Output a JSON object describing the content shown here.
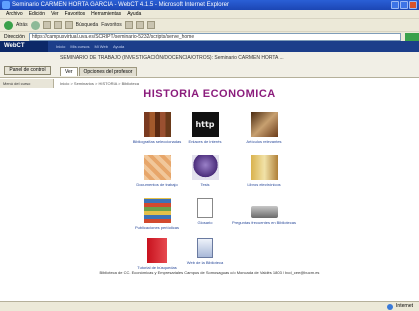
{
  "window": {
    "title": "Seminario CARMEN HORTA GARCIA - WebCT 4.1.5 - Microsoft Internet Explorer"
  },
  "menu": [
    "Archivo",
    "Edición",
    "Ver",
    "Favoritos",
    "Herramientas",
    "Ayuda"
  ],
  "toolbar": {
    "back_label": "Atrás",
    "search_label": "Búsqueda",
    "favorites_label": "Favoritos"
  },
  "address": {
    "label": "Dirección",
    "value": "https://campusvirtual.uva.es/SCRIPT/seminario-5232/scripts/serve_home"
  },
  "app": {
    "logo": "WebCT",
    "nav": [
      "Inicio",
      "Mis cursos",
      "Mi Web",
      "Ayuda"
    ]
  },
  "course": {
    "title": "SEMINARIO DE TRABAJO (INVESTIGACIÓN/DOCENCIA/OTROS): Seminario CARMEN HORTA ...",
    "panel_button": "Panel de control",
    "tabs": [
      "Ver",
      "Opciones del profesor"
    ]
  },
  "breadcrumb": {
    "menu": "Menú del curso",
    "path": "Inicio > Seminarios > HISTORIA > Biblioteca"
  },
  "page_title": "HISTORIA ECONOMICA",
  "items": [
    {
      "label": "Bibliografías seleccionadas",
      "icon": "books-icon"
    },
    {
      "label": "Enlaces de interés",
      "icon": "http-icon"
    },
    {
      "label": "Artículos relevantes",
      "icon": "open-book-icon"
    },
    {
      "label": "Documentos de trabajo",
      "icon": "documents-icon"
    },
    {
      "label": "Tesis",
      "icon": "graduation-cap-icon"
    },
    {
      "label": "Libros electrónicos",
      "icon": "ebooks-icon"
    },
    {
      "label": "Publicaciones periódicas",
      "icon": "periodicals-icon"
    },
    {
      "label": "Glosario",
      "icon": "board-icon"
    },
    {
      "label": "Preguntas frecuentes en Bibliotecas",
      "icon": "projector-icon"
    },
    {
      "label": "Tutorial de búsquedas",
      "icon": "folder-icon"
    },
    {
      "label": "Web de la Biblioteca",
      "icon": "file-icon"
    }
  ],
  "footer": "Biblioteca de CC. Económicas y Empresariales Campus de Somosaguas c/o Moncada de Valdés 1803 / bcd_cee@bucm.es",
  "status": {
    "left": "",
    "zone": "Internet"
  }
}
